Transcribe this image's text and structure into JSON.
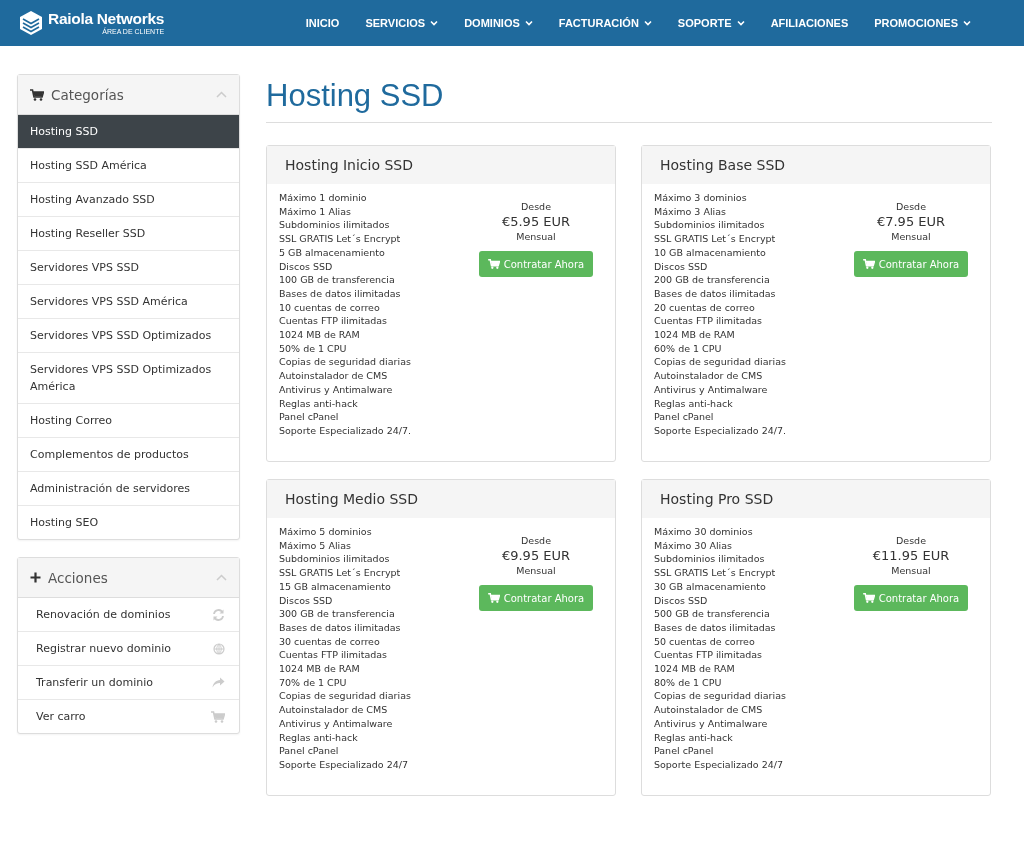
{
  "brand": {
    "name": "Raiola Networks",
    "subtitle": "ÁREA DE CLIENTE"
  },
  "nav": [
    {
      "label": "INICIO",
      "dropdown": false
    },
    {
      "label": "SERVICIOS",
      "dropdown": true
    },
    {
      "label": "DOMINIOS",
      "dropdown": true
    },
    {
      "label": "FACTURACIÓN",
      "dropdown": true
    },
    {
      "label": "SOPORTE",
      "dropdown": true
    },
    {
      "label": "AFILIACIONES",
      "dropdown": false
    },
    {
      "label": "PROMOCIONES",
      "dropdown": true
    }
  ],
  "categories": {
    "title": "Categorías",
    "items": [
      {
        "label": "Hosting SSD",
        "selected": true
      },
      {
        "label": "Hosting SSD América",
        "selected": false
      },
      {
        "label": "Hosting Avanzado SSD",
        "selected": false
      },
      {
        "label": "Hosting Reseller SSD",
        "selected": false
      },
      {
        "label": "Servidores VPS SSD",
        "selected": false
      },
      {
        "label": "Servidores VPS SSD América",
        "selected": false
      },
      {
        "label": "Servidores VPS SSD Optimizados",
        "selected": false
      },
      {
        "label": "Servidores VPS SSD Optimizados América",
        "selected": false
      },
      {
        "label": "Hosting Correo",
        "selected": false
      },
      {
        "label": "Complementos de productos",
        "selected": false
      },
      {
        "label": "Administración de servidores",
        "selected": false
      },
      {
        "label": "Hosting SEO",
        "selected": false
      }
    ]
  },
  "actions": {
    "title": "Acciones",
    "items": [
      "Renovación de dominios",
      "Registrar nuevo dominio",
      "Transferir un dominio",
      "Ver carro"
    ]
  },
  "page_title": "Hosting SSD",
  "products": [
    {
      "name": "Hosting Inicio SSD",
      "features": [
        "Máximo 1 dominio",
        "Máximo 1 Alias",
        "Subdominios ilimitados",
        "SSL GRATIS Let´s Encrypt",
        "5 GB almacenamiento",
        "Discos SSD",
        "100 GB de transferencia",
        "Bases de datos ilimitadas",
        "10 cuentas de correo",
        "Cuentas FTP ilimitadas",
        "1024 MB de RAM",
        "50% de 1 CPU",
        "Copias de seguridad diarias",
        "Autoinstalador de CMS",
        "Antivirus y Antimalware",
        "Reglas anti-hack",
        "Panel cPanel",
        "Soporte Especializado 24/7."
      ],
      "from": "Desde",
      "price": "€5.95 EUR",
      "period": "Mensual",
      "button": "Contratar Ahora"
    },
    {
      "name": "Hosting Base SSD",
      "features": [
        "Máximo 3 dominios",
        "Máximo 3 Alias",
        "Subdominios ilimitados",
        "SSL GRATIS Let´s Encrypt",
        "10 GB almacenamiento",
        "Discos SSD",
        "200 GB de transferencia",
        "Bases de datos ilimitadas",
        "20 cuentas de correo",
        "Cuentas FTP ilimitadas",
        "1024 MB de RAM",
        "60% de 1 CPU",
        "Copias de seguridad diarias",
        "Autoinstalador de CMS",
        "Antivirus y Antimalware",
        "Reglas anti-hack",
        "Panel cPanel",
        "Soporte Especializado 24/7."
      ],
      "from": "Desde",
      "price": "€7.95 EUR",
      "period": "Mensual",
      "button": "Contratar Ahora"
    },
    {
      "name": "Hosting Medio SSD",
      "features": [
        "Máximo 5 dominios",
        "Máximo 5 Alias",
        "Subdominios ilimitados",
        "SSL GRATIS Let´s Encrypt",
        "15 GB almacenamiento",
        "Discos SSD",
        "300 GB de transferencia",
        "Bases de datos ilimitadas",
        "30 cuentas de correo",
        "Cuentas FTP ilimitadas",
        "1024 MB de RAM",
        "70% de 1 CPU",
        "Copias de seguridad diarias",
        "Autoinstalador de CMS",
        "Antivirus y Antimalware",
        "Reglas anti-hack",
        "Panel cPanel",
        "Soporte Especializado 24/7"
      ],
      "from": "Desde",
      "price": "€9.95 EUR",
      "period": "Mensual",
      "button": "Contratar Ahora"
    },
    {
      "name": "Hosting Pro SSD",
      "features": [
        "Máximo 30 dominios",
        "Máximo 30 Alias",
        "Subdominios ilimitados",
        "SSL GRATIS Let´s Encrypt",
        "30 GB almacenamiento",
        "Discos SSD",
        "500 GB de transferencia",
        "Bases de datos ilimitadas",
        "50 cuentas de correo",
        "Cuentas FTP ilimitadas",
        "1024 MB de RAM",
        "80% de 1 CPU",
        "Copias de seguridad diarias",
        "Autoinstalador de CMS",
        "Antivirus y Antimalware",
        "Reglas anti-hack",
        "Panel cPanel",
        "Soporte Especializado 24/7"
      ],
      "from": "Desde",
      "price": "€11.95 EUR",
      "period": "Mensual",
      "button": "Contratar Ahora"
    }
  ]
}
